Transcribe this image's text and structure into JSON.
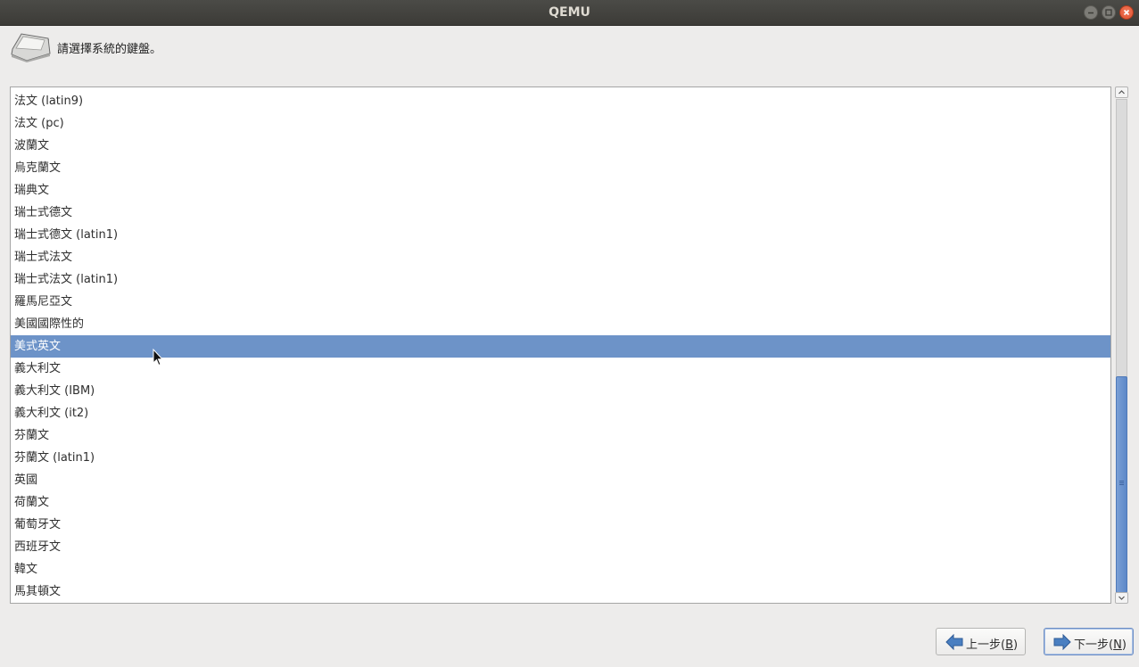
{
  "window": {
    "title": "QEMU"
  },
  "icons": {
    "minimize": "minimize-icon",
    "maximize": "maximize-icon",
    "close": "close-icon",
    "keyboard": "keyboard-key-icon",
    "back": "arrow-left-icon",
    "next": "arrow-right-icon"
  },
  "colors": {
    "selection": "#6d93c8",
    "close_button": "#e0502d"
  },
  "header": {
    "prompt": "請選擇系統的鍵盤。"
  },
  "keyboard_list": {
    "selected_index": 11,
    "items": [
      "法文 (latin9)",
      "法文 (pc)",
      "波蘭文",
      "烏克蘭文",
      "瑞典文",
      "瑞士式德文",
      "瑞士式德文 (latin1)",
      "瑞士式法文",
      "瑞士式法文 (latin1)",
      "羅馬尼亞文",
      "美國國際性的",
      "美式英文",
      "義大利文",
      "義大利文 (IBM)",
      "義大利文 (it2)",
      "芬蘭文",
      "芬蘭文 (latin1)",
      "英國",
      "荷蘭文",
      "葡萄牙文",
      "西班牙文",
      "韓文",
      "馬其頓文"
    ]
  },
  "buttons": {
    "back": {
      "text": "上一步(",
      "mnemonic": "B",
      "close": ")"
    },
    "next": {
      "text": "下一步(",
      "mnemonic": "N",
      "close": ")"
    }
  }
}
